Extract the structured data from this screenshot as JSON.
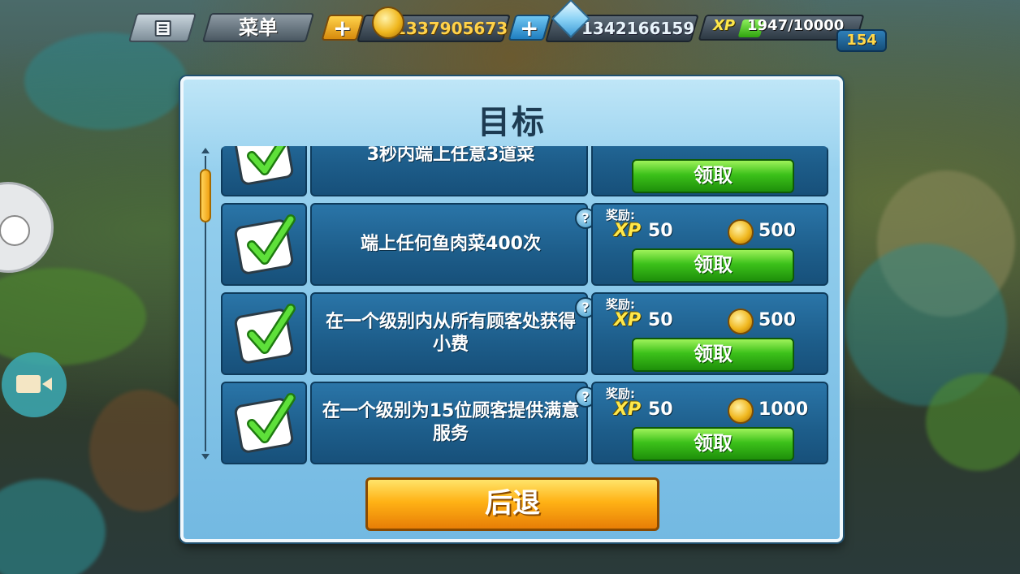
{
  "topbar": {
    "menu_label": "菜单",
    "plus_symbol": "+",
    "coins": "1337905673",
    "gems": "1342166159",
    "xp_label": "XP",
    "xp_progress": "1947/10000",
    "xp_fraction": 0.1947,
    "level": "154"
  },
  "dialog": {
    "title": "目标",
    "reward_label": "奖励:",
    "help_symbol": "?",
    "xp_badge": "XP",
    "claim_label": "领取",
    "back_label": "后退",
    "goals": [
      {
        "desc": "3秒内端上任意3道菜",
        "xp": "",
        "coins": ""
      },
      {
        "desc": "端上任何鱼肉菜400次",
        "xp": "50",
        "coins": "500"
      },
      {
        "desc": "在一个级别内从所有顾客处获得小费",
        "xp": "50",
        "coins": "500"
      },
      {
        "desc": "在一个级别为15位顾客提供满意服务",
        "xp": "50",
        "coins": "1000"
      }
    ]
  },
  "colors": {
    "claim_green": "#3cc11a",
    "back_orange": "#ffb215",
    "dialog_blue": "#73b9e2"
  }
}
